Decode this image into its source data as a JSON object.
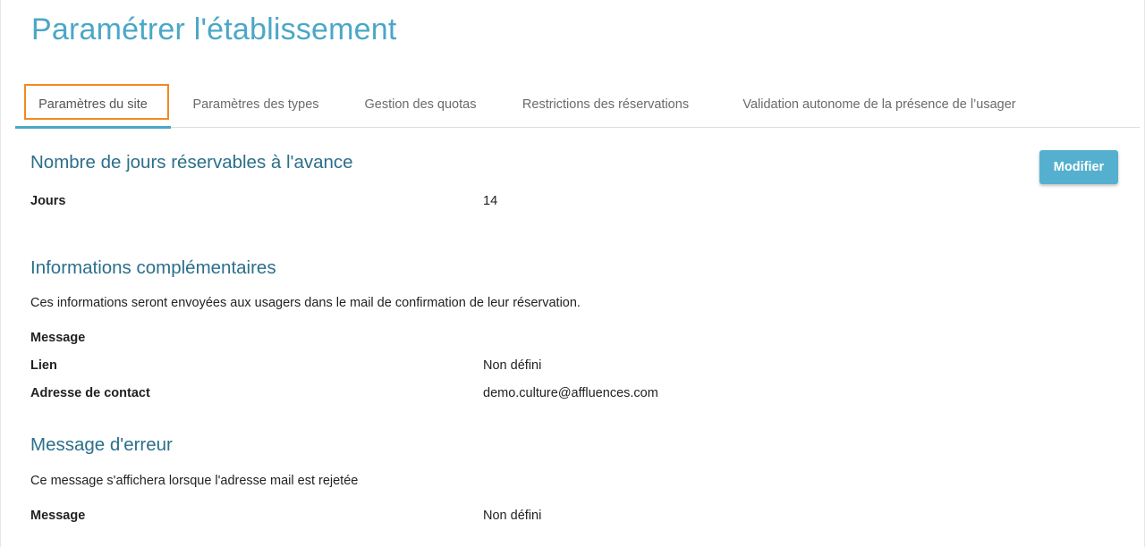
{
  "header": {
    "title": "Paramétrer l'établissement"
  },
  "tabs": [
    {
      "label": "Paramètres du site",
      "active": true
    },
    {
      "label": "Paramètres des types"
    },
    {
      "label": "Gestion des quotas"
    },
    {
      "label": "Restrictions des réservations"
    },
    {
      "label": "Validation autonome de la présence de l’usager"
    }
  ],
  "actions": {
    "modify_label": "Modifier"
  },
  "sections": {
    "advance_days": {
      "title": "Nombre de jours réservables à l'avance",
      "days_label": "Jours",
      "days_value": "14"
    },
    "additional_info": {
      "title": "Informations complémentaires",
      "description": "Ces informations seront envoyées aux usagers dans le mail de confirmation de leur réservation.",
      "message_label": "Message",
      "link_label": "Lien",
      "link_value": "Non défini",
      "contact_label": "Adresse de contact",
      "contact_value": "demo.culture@affluences.com"
    },
    "error_message": {
      "title": "Message d'erreur",
      "description": "Ce message s'affichera lorsque l'adresse mail est rejetée",
      "message_label": "Message",
      "message_value": "Non défini"
    }
  },
  "colors": {
    "accent": "#4ba7c7",
    "section_title": "#2b6f8a",
    "focus_outline": "#f08a24",
    "button": "#55b0cf"
  }
}
